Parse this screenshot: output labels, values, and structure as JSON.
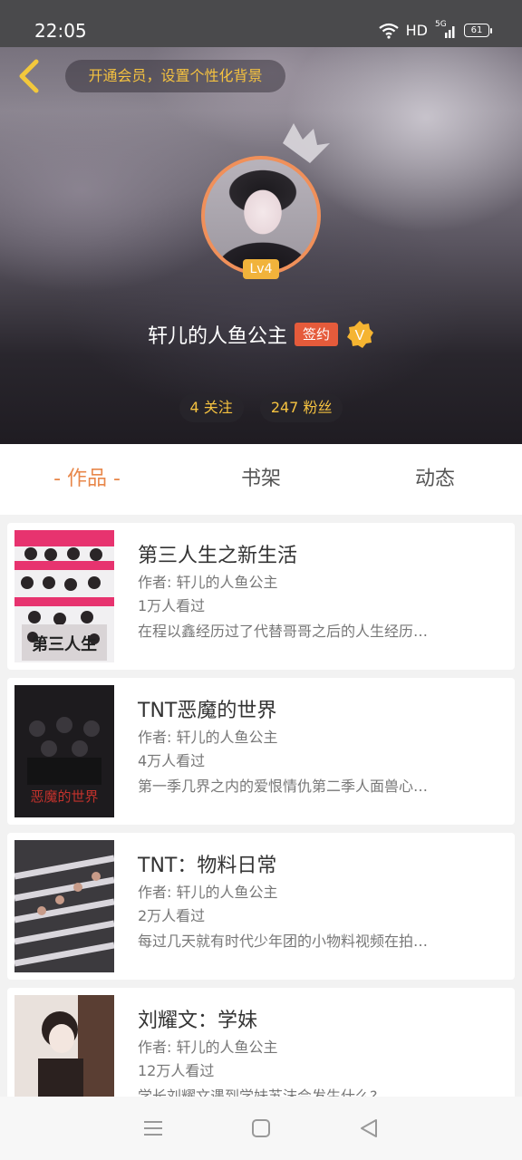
{
  "status_bar": {
    "time": "22:05",
    "network": "HD",
    "signal": "5G",
    "battery": "61"
  },
  "header": {
    "vip_prompt": "开通会员，设置个性化背景",
    "level": "Lv4",
    "username": "轩儿的人鱼公主",
    "sign_badge": "签约",
    "verified_letter": "V",
    "following": "4 关注",
    "followers": "247 粉丝"
  },
  "tabs": [
    {
      "label": "- 作品 -",
      "active": true
    },
    {
      "label": "书架",
      "active": false
    },
    {
      "label": "动态",
      "active": false
    }
  ],
  "works": [
    {
      "title": "第三人生之新生活",
      "author": "作者: 轩儿的人鱼公主",
      "views": "1万人看过",
      "desc": "在程以鑫经历过了代替哥哥之后的人生经历…",
      "cover_colors": [
        "#e7336f",
        "#ffffff"
      ],
      "cover_text": "第三人生"
    },
    {
      "title": "TNT恶魔的世界",
      "author": "作者: 轩儿的人鱼公主",
      "views": "4万人看过",
      "desc": "第一季几界之内的爱恨情仇第二季人面兽心…",
      "cover_colors": [
        "#1d1b1e",
        "#c2322c"
      ],
      "cover_text": "恶魔的世界"
    },
    {
      "title": "TNT：物料日常",
      "author": "作者: 轩儿的人鱼公主",
      "views": "2万人看过",
      "desc": "每过几天就有时代少年团的小物料视频在拍…",
      "cover_colors": [
        "#3c3a3e",
        "#d9d6dc"
      ]
    },
    {
      "title": "刘耀文：学妹",
      "author": "作者: 轩儿的人鱼公主",
      "views": "12万人看过",
      "desc": "学长刘耀文遇到学妹苏沫会发生什么?",
      "cover_colors": [
        "#e9e1dc",
        "#2b211f"
      ]
    }
  ],
  "colors": {
    "accent": "#e8874a",
    "gold": "#f5c240",
    "sign_red": "#e55b3b",
    "avatar_ring": "#f0905a"
  },
  "icons": [
    "back-icon",
    "crown-icon",
    "verified-v-icon",
    "wifi-icon",
    "signal-icon",
    "menu-icon",
    "home-icon",
    "back-triangle-icon"
  ]
}
